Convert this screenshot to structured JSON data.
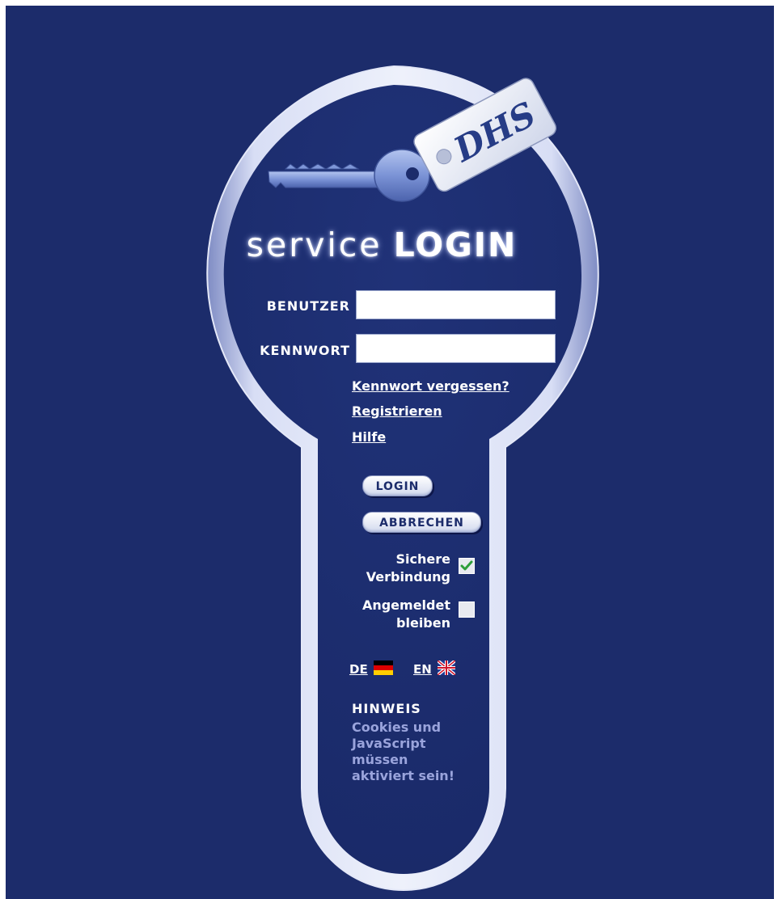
{
  "title": {
    "part1": "service",
    "part2": "LOGIN"
  },
  "keytag": {
    "logo_text": "DHS"
  },
  "form": {
    "username_label": "BENUTZER",
    "username_value": "",
    "password_label": "KENNWORT",
    "password_value": ""
  },
  "links": {
    "forgot_password": "Kennwort vergessen?",
    "register": "Registrieren",
    "help": "Hilfe"
  },
  "buttons": {
    "login": "LOGIN",
    "cancel": "ABBRECHEN"
  },
  "options": {
    "secure_connection": {
      "line1": "Sichere",
      "line2": "Verbindung",
      "checked": true
    },
    "stay_logged_in": {
      "line1": "Angemeldet",
      "line2": "bleiben",
      "checked": false
    }
  },
  "languages": [
    {
      "code": "DE",
      "flag_icon": "germany-flag-icon"
    },
    {
      "code": "EN",
      "flag_icon": "uk-flag-icon"
    }
  ],
  "notice": {
    "title": "HINWEIS",
    "line1": "Cookies und",
    "line2": "JavaScript",
    "line3": "müssen",
    "line4": "aktiviert sein!"
  },
  "colors": {
    "background": "#1c2c6b",
    "keyhole_rim": "#c4ccec",
    "hint_text": "#9aa4dc",
    "check_mark": "#2e9e3a"
  }
}
